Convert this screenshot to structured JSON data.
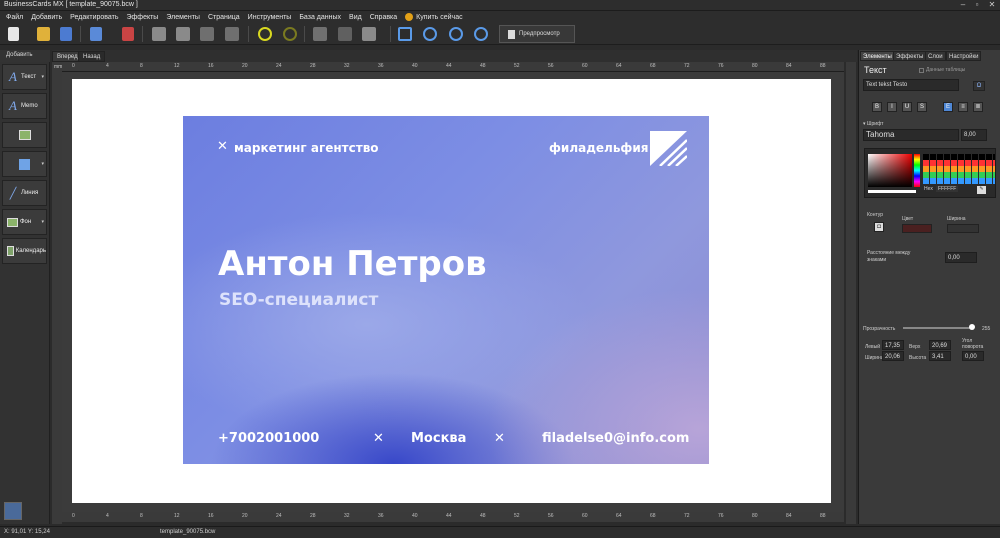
{
  "window": {
    "title": "BusinessCards MX [ template_90075.bcw ]"
  },
  "menu": [
    "Файл",
    "Добавить",
    "Редактировать",
    "Эффекты",
    "Элементы",
    "Страница",
    "Инструменты",
    "База данных",
    "Вид",
    "Справка"
  ],
  "menu_buy": "Купить сейчас",
  "toolbar": {
    "preview_label": "Предпросмотр"
  },
  "left_panel": {
    "header": "Добавить",
    "buttons": [
      {
        "label": "Текст",
        "icon": "text-icon"
      },
      {
        "label": "Memo",
        "icon": "memo-icon"
      },
      {
        "label": "",
        "icon": "image-icon"
      },
      {
        "label": "",
        "icon": "shape-icon"
      },
      {
        "label": "Линия",
        "icon": "line-icon"
      },
      {
        "label": "Фон",
        "icon": "background-icon"
      },
      {
        "label": "Календарь",
        "icon": "calendar-icon"
      }
    ]
  },
  "doc_tabs": {
    "forward": "Вперед",
    "back": "Назад"
  },
  "ruler": {
    "unit": "mm",
    "ticks": [
      "0",
      "4",
      "8",
      "12",
      "16",
      "20",
      "24",
      "28",
      "32",
      "36",
      "40",
      "44",
      "48",
      "52",
      "56",
      "60",
      "64",
      "68",
      "72",
      "76",
      "80",
      "84",
      "88"
    ]
  },
  "card": {
    "tagline": "маркетинг агентство",
    "brand": "филадельфия",
    "name": "Антон Петров",
    "role": "SEO-специалист",
    "phone": "+7002001000",
    "city": "Москва",
    "email": "filadelse0@info.com",
    "cross": "✕"
  },
  "right_panel": {
    "tabs": [
      "Элементы",
      "Эффекты",
      "Слои",
      "Настройки"
    ],
    "section_title": "Текст",
    "db_checkbox": "Данные таблицы",
    "text_value": "Text tekst Testo",
    "omega": "Ω",
    "format_buttons": [
      "B",
      "I",
      "U",
      "S",
      "E",
      "≡",
      "≣"
    ],
    "font_header": "Шрифт",
    "font_name": "Tahoma",
    "font_size": "8,00",
    "hex_label": "Hex",
    "hex_value": "FFFFFF",
    "contour_label": "Контур",
    "color_label": "Цвет",
    "width_label": "Ширина",
    "letter_spacing_label": "Расстояние между знаками",
    "letter_spacing": "0,00",
    "opacity_label": "Прозрачность",
    "opacity_value": "255",
    "left_label": "Левый",
    "left_value": "17,35",
    "top_label": "Верх",
    "top_value": "20,69",
    "angle_label": "Угол поворота",
    "width2_label": "Ширина",
    "width2_value": "20,06",
    "height_label": "Высота",
    "height_value": "3,41",
    "angle_value": "0,00"
  },
  "status": {
    "coords": "X: 91,01 Y: 15,24",
    "file": "template_90075.bcw"
  }
}
